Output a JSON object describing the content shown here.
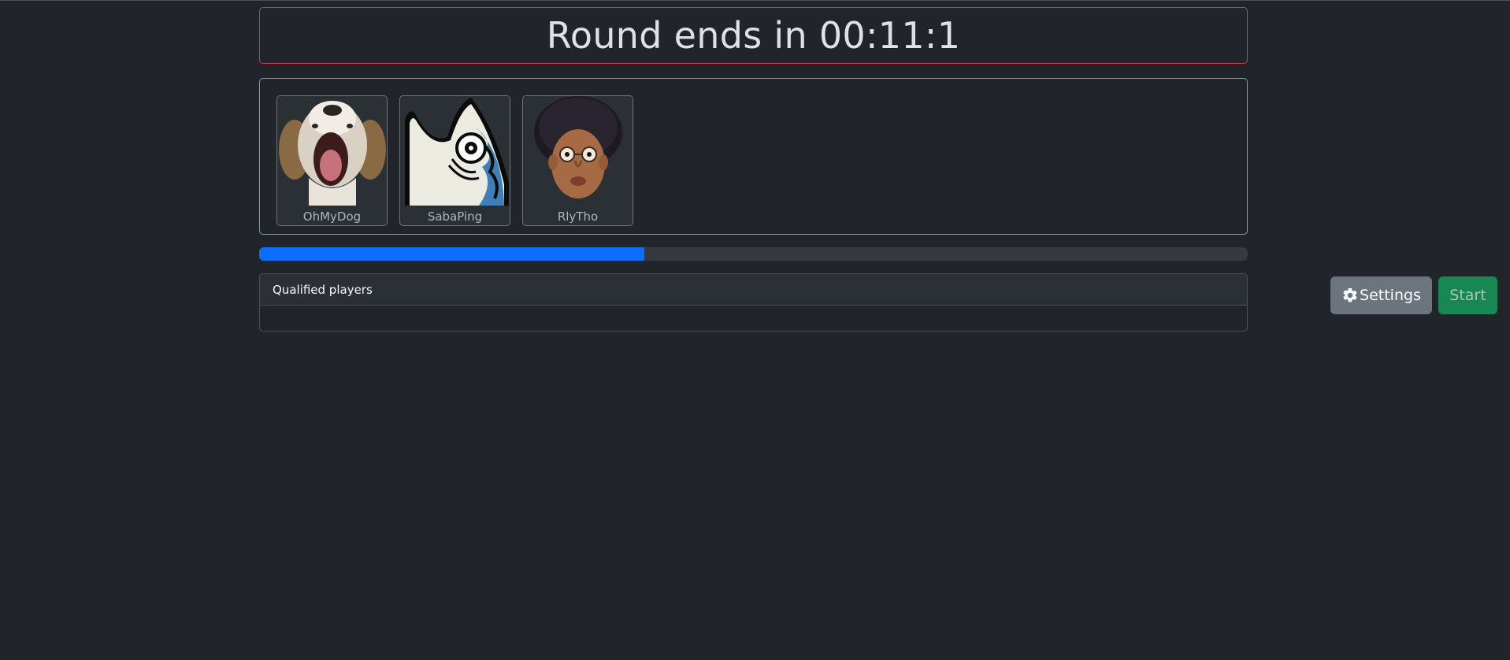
{
  "header": {
    "timer_text": "Round ends in 00:11:1"
  },
  "players": [
    {
      "name": "OhMyDog",
      "avatar": "dog-emote"
    },
    {
      "name": "SabaPing",
      "avatar": "fish-emote"
    },
    {
      "name": "RlyTho",
      "avatar": "face-emote"
    }
  ],
  "progress": {
    "fraction": 0.39
  },
  "qualified": {
    "title": "Qualified players",
    "items": []
  },
  "actions": {
    "settings_label": "Settings",
    "settings_icon": "gear-icon",
    "start_label": "Start"
  },
  "colors": {
    "background": "#212529",
    "timer_border": "#dc3545",
    "players_border": "#0dcaf0",
    "progress_fill": "#0d6efd",
    "settings_bg": "#6c757d",
    "start_bg": "#198754"
  }
}
